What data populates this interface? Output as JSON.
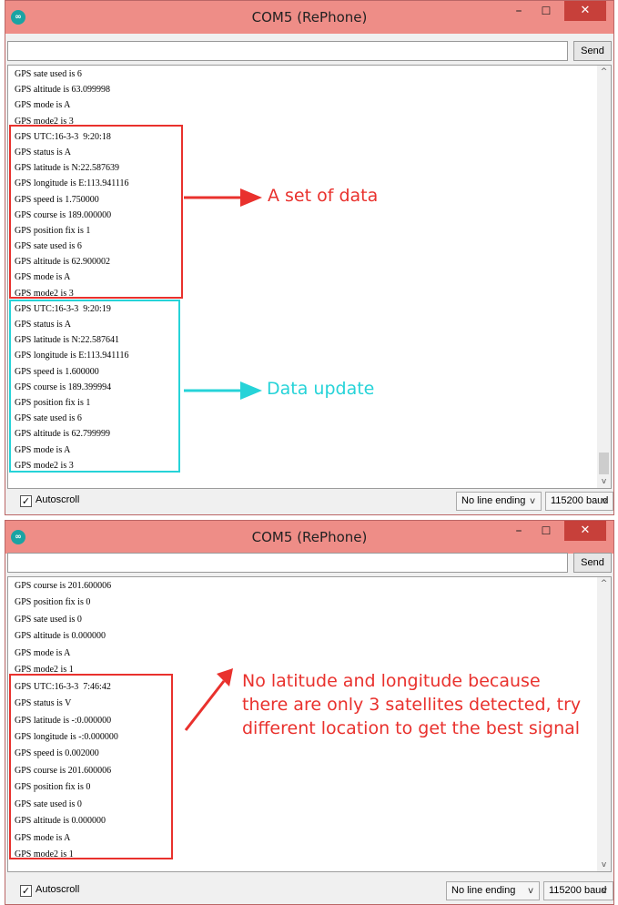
{
  "windows": [
    {
      "title": "COM5 (RePhone)",
      "app_icon": "arduino-icon",
      "send_label": "Send",
      "send_input_value": "",
      "lines": [
        "GPS sate used is 6",
        "GPS altitude is 63.099998",
        "GPS mode is A",
        "GPS mode2 is 3",
        "GPS UTC:16-3-3  9:20:18",
        "GPS status is A",
        "GPS latitude is N:22.587639",
        "GPS longitude is E:113.941116",
        "GPS speed is 1.750000",
        "GPS course is 189.000000",
        "GPS position fix is 1",
        "GPS sate used is 6",
        "GPS altitude is 62.900002",
        "GPS mode is A",
        "GPS mode2 is 3",
        "GPS UTC:16-3-3  9:20:19",
        "GPS status is A",
        "GPS latitude is N:22.587641",
        "GPS longitude is E:113.941116",
        "GPS speed is 1.600000",
        "GPS course is 189.399994",
        "GPS position fix is 1",
        "GPS sate used is 6",
        "GPS altitude is 62.799999",
        "GPS mode is A",
        "GPS mode2 is 3"
      ],
      "autoscroll_label": "Autoscroll",
      "autoscroll_checked": true,
      "line_ending": "No line ending",
      "baud": "115200 baud"
    },
    {
      "title": "COM5 (RePhone)",
      "app_icon": "arduino-icon",
      "send_label": "Send",
      "send_input_value": "",
      "lines": [
        "GPS course is 201.600006",
        "GPS position fix is 0",
        "GPS sate used is 0",
        "GPS altitude is 0.000000",
        "GPS mode is A",
        "GPS mode2 is 1",
        "GPS UTC:16-3-3  7:46:42",
        "GPS status is V",
        "GPS latitude is -:0.000000",
        "GPS longitude is -:0.000000",
        "GPS speed is 0.002000",
        "GPS course is 201.600006",
        "GPS position fix is 0",
        "GPS sate used is 0",
        "GPS altitude is 0.000000",
        "GPS mode is A",
        "GPS mode2 is 1"
      ],
      "autoscroll_label": "Autoscroll",
      "autoscroll_checked": true,
      "line_ending": "No line ending",
      "baud": "115200 baud"
    }
  ],
  "annotations": {
    "set_of_data": "A set of data",
    "data_update": "Data update",
    "no_fix_line1": "No latitude and longitude because",
    "no_fix_line2": "there are only 3 satellites detected, try",
    "no_fix_line3": "different location to get the best signal"
  },
  "colors": {
    "titlebar": "#ee8d87",
    "annotation_red": "#e9312d",
    "annotation_cyan": "#26d3d8"
  }
}
